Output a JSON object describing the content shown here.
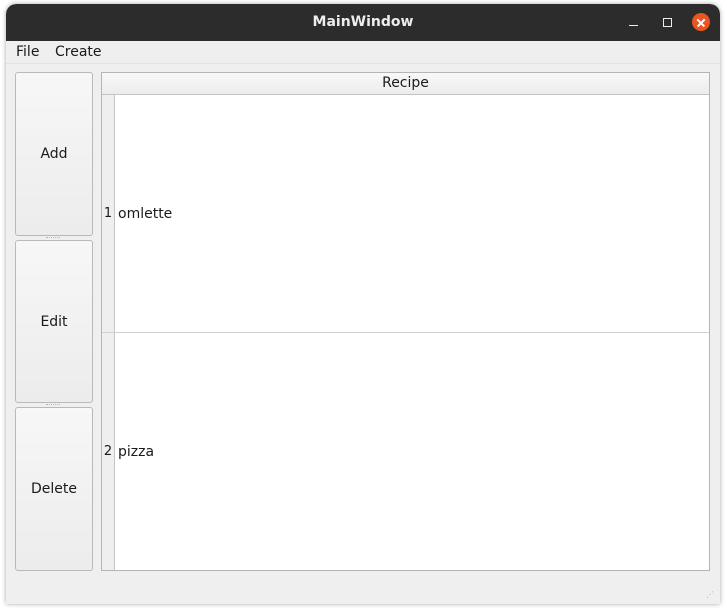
{
  "window": {
    "title": "MainWindow",
    "controls": {
      "minimize": "minimize-icon",
      "maximize": "maximize-icon",
      "close": "close-icon"
    },
    "accent_color": "#e95420"
  },
  "menubar": {
    "items": [
      {
        "label": "File"
      },
      {
        "label": "Create"
      }
    ]
  },
  "sidebar": {
    "add_label": "Add",
    "edit_label": "Edit",
    "delete_label": "Delete"
  },
  "table": {
    "columns": [
      "Recipe"
    ],
    "rows": [
      {
        "header": "1",
        "recipe": "omlette"
      },
      {
        "header": "2",
        "recipe": "pizza"
      }
    ]
  }
}
